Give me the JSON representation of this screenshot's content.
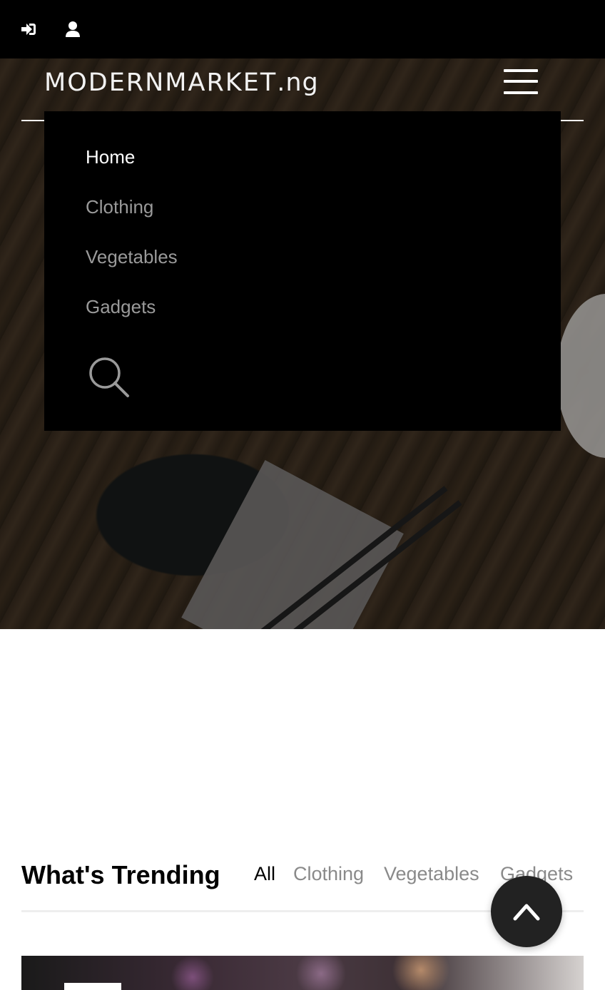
{
  "topbar": {
    "icons": [
      "sign-in-icon",
      "user-icon"
    ]
  },
  "brand": {
    "name": "MODERNMARKET",
    "tld": ".ng"
  },
  "nav": {
    "items": [
      {
        "label": "Home",
        "active": true
      },
      {
        "label": "Clothing",
        "active": false
      },
      {
        "label": "Vegetables",
        "active": false
      },
      {
        "label": "Gadgets",
        "active": false
      }
    ],
    "search_icon": "search-icon",
    "menu_icon": "hamburger-menu-icon"
  },
  "trending": {
    "title": "What's Trending",
    "filters": [
      {
        "label": "All",
        "active": true
      },
      {
        "label": "Clothing",
        "active": false
      },
      {
        "label": "Vegetables",
        "active": false
      },
      {
        "label": "Gadgets",
        "active": false
      }
    ]
  },
  "scroll_top": {
    "icon": "chevron-up-icon"
  },
  "colors": {
    "topbar": "#000000",
    "menu_bg": "#000000",
    "menu_active": "#ffffff",
    "menu_inactive": "#9a9a9a",
    "filter_active": "#000000",
    "filter_inactive": "#8a8a8a",
    "scroll_button": "#222222"
  }
}
